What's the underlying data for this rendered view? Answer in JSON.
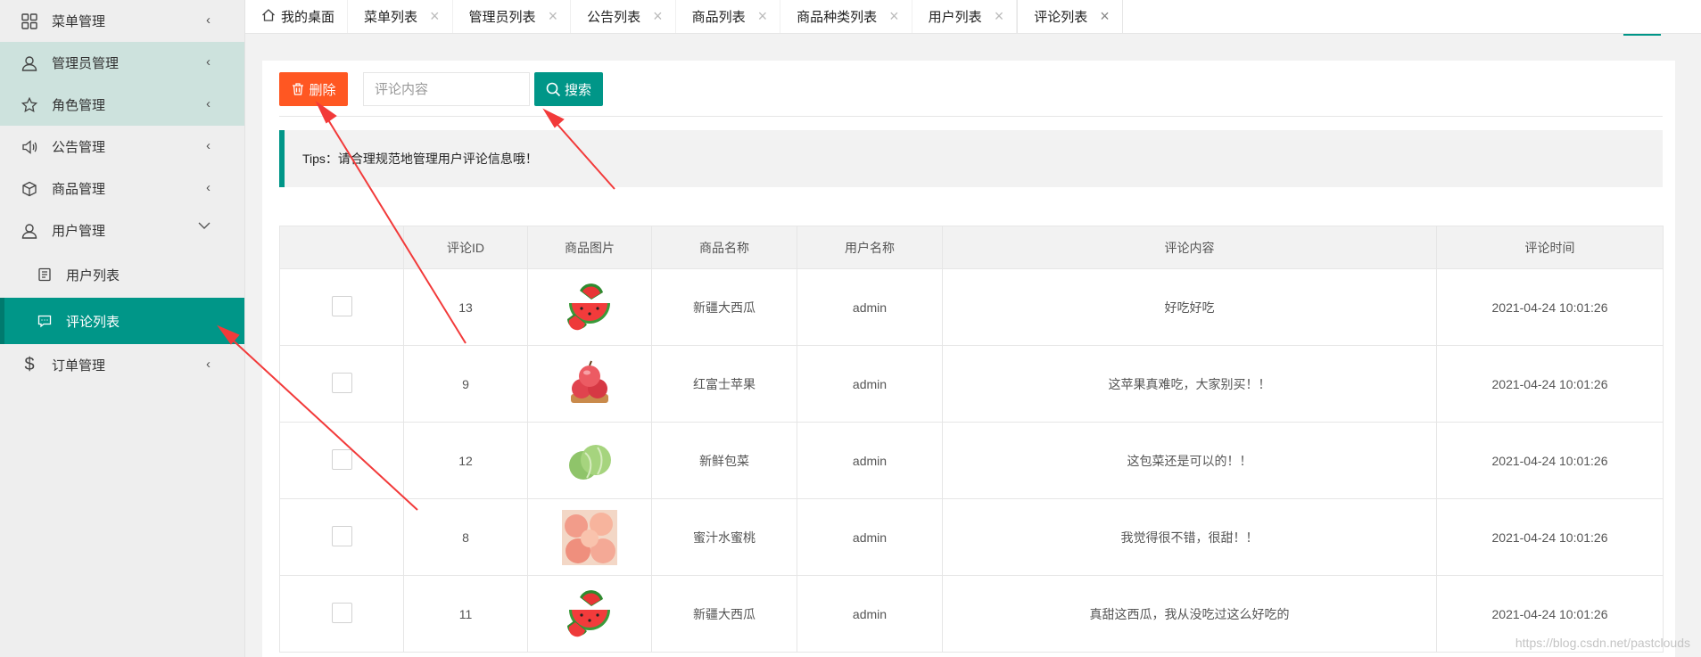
{
  "sidebar": {
    "items": [
      {
        "label": "菜单管理",
        "icon": "grid-icon",
        "expanded": false
      },
      {
        "label": "管理员管理",
        "icon": "user-icon",
        "expanded": false
      },
      {
        "label": "角色管理",
        "icon": "star-icon",
        "expanded": false
      },
      {
        "label": "公告管理",
        "icon": "speaker-icon",
        "expanded": false
      },
      {
        "label": "商品管理",
        "icon": "box-icon",
        "expanded": false
      },
      {
        "label": "用户管理",
        "icon": "user-icon",
        "expanded": true,
        "children": [
          {
            "label": "用户列表",
            "icon": "list-icon"
          },
          {
            "label": "评论列表",
            "icon": "comment-icon",
            "active": true
          }
        ]
      },
      {
        "label": "订单管理",
        "icon": "dollar-icon",
        "expanded": false
      }
    ]
  },
  "tabs": [
    {
      "label": "我的桌面",
      "home": true
    },
    {
      "label": "菜单列表"
    },
    {
      "label": "管理员列表"
    },
    {
      "label": "公告列表"
    },
    {
      "label": "商品列表"
    },
    {
      "label": "商品种类列表"
    },
    {
      "label": "用户列表"
    },
    {
      "label": "评论列表",
      "active": true
    }
  ],
  "toolbar": {
    "delete_label": "删除",
    "search_placeholder": "评论内容",
    "search_label": "搜索"
  },
  "tips": "Tips：请合理规范地管理用户评论信息哦！",
  "table": {
    "columns": [
      "",
      "评论ID",
      "商品图片",
      "商品名称",
      "用户名称",
      "评论内容",
      "评论时间"
    ],
    "rows": [
      {
        "id": "13",
        "image": "watermelon",
        "product": "新疆大西瓜",
        "user": "admin",
        "content": "好吃好吃",
        "time": "2021-04-24 10:01:26"
      },
      {
        "id": "9",
        "image": "apple",
        "product": "红富士苹果",
        "user": "admin",
        "content": "这苹果真难吃，大家别买！！",
        "time": "2021-04-24 10:01:26"
      },
      {
        "id": "12",
        "image": "cabbage",
        "product": "新鲜包菜",
        "user": "admin",
        "content": "这包菜还是可以的！！",
        "time": "2021-04-24 10:01:26"
      },
      {
        "id": "8",
        "image": "peach",
        "product": "蜜汁水蜜桃",
        "user": "admin",
        "content": "我觉得很不错，很甜！！",
        "time": "2021-04-24 10:01:26"
      },
      {
        "id": "11",
        "image": "watermelon",
        "product": "新疆大西瓜",
        "user": "admin",
        "content": "真甜这西瓜，我从没吃过这么好吃的",
        "time": "2021-04-24 10:01:26"
      }
    ]
  },
  "watermark": "https://blog.csdn.net/pastclouds",
  "colors": {
    "accent": "#009688",
    "danger": "#ff5722",
    "annotation": "#f23a3a"
  }
}
